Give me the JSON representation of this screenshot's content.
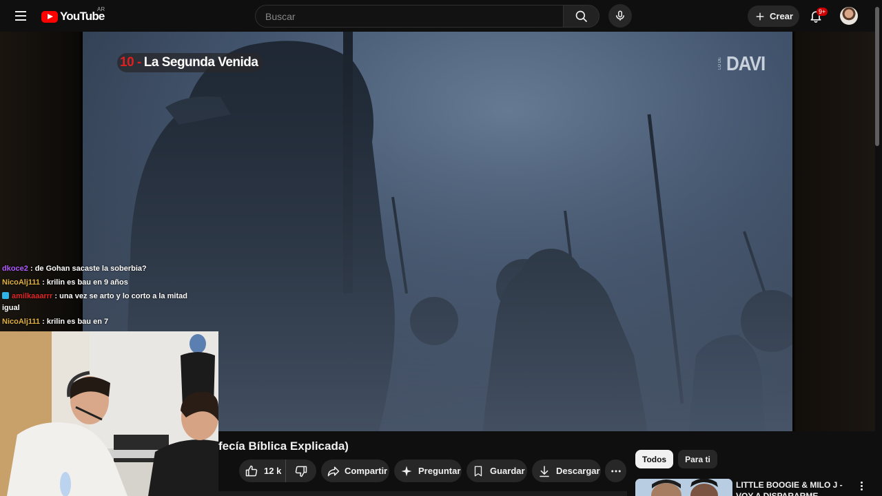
{
  "header": {
    "logo_text": "YouTube",
    "region": "AR",
    "search_placeholder": "Buscar",
    "create_label": "Crear",
    "notifications_badge": "9+"
  },
  "video": {
    "overlay_number": "10 -",
    "overlay_title": "La Segunda Venida",
    "watermark_small": "LO DE",
    "watermark_big": "DAVI"
  },
  "chat": {
    "messages": [
      {
        "user": "dkoce2",
        "user_color": "#b05bff",
        "text": ": de Gohan sacaste la soberbia?"
      },
      {
        "user": "NicoAlj111",
        "user_color": "#e0b040",
        "text": ": krilin es bau en 9 años"
      },
      {
        "user": "amilkaaarrr",
        "user_color": "#e02828",
        "text": ": una vez se arto y lo corto a la mitad igual"
      },
      {
        "user": "NicoAlj111",
        "user_color": "#e0b040",
        "text": ": krilin es bau en 7"
      }
    ]
  },
  "below_player": {
    "title_fragment": "fecía Bíblica Explicada)",
    "like_count": "12 k",
    "share_label": "Compartir",
    "ask_label": "Preguntar",
    "save_label": "Guardar",
    "download_label": "Descargar"
  },
  "sidebar": {
    "chips": [
      "Todos",
      "Para ti"
    ],
    "active_chip": "Todos",
    "recommendation_title": "LITTLE BOOGIE & MILO J - VOY A DISPARARME (VIDEOCLIP"
  },
  "colors": {
    "background": "#0f0f0f",
    "accent": "#ff0000",
    "pill": "#272727"
  }
}
